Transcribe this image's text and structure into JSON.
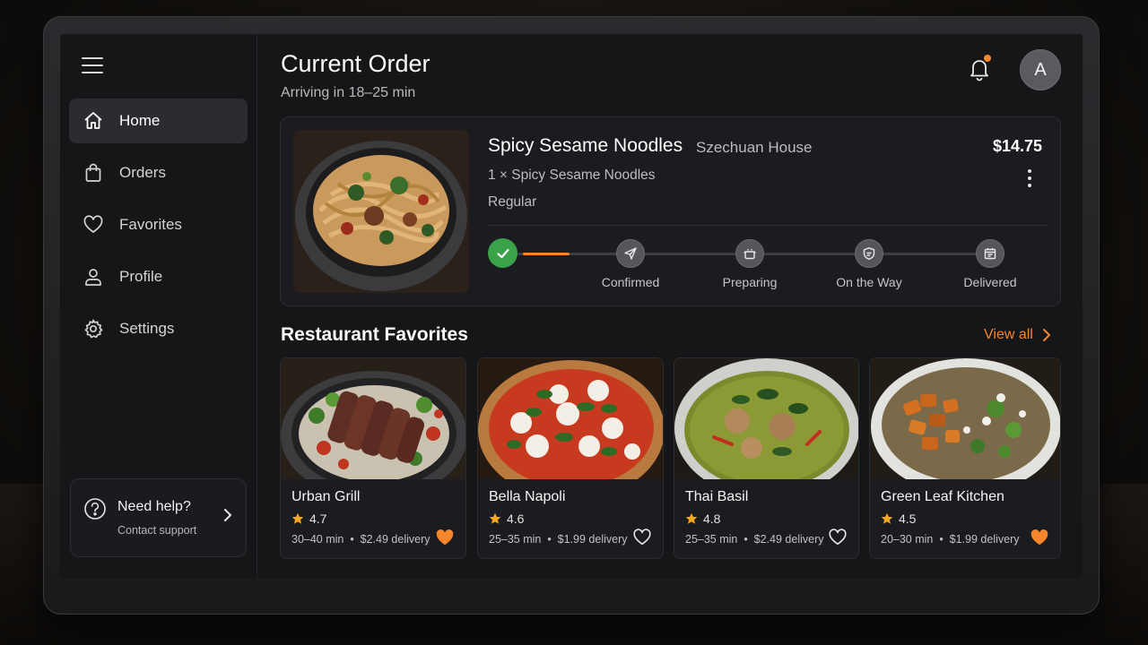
{
  "sidebar": {
    "items": [
      {
        "label": "Home",
        "icon": "home-icon",
        "active": true
      },
      {
        "label": "Orders",
        "icon": "shopping-bag-icon"
      },
      {
        "label": "Favorites",
        "icon": "heart-icon"
      },
      {
        "label": "Profile",
        "icon": "user-icon"
      },
      {
        "label": "Settings",
        "icon": "gear-icon"
      }
    ],
    "help": {
      "title": "Need help?",
      "subtitle": "Contact support"
    }
  },
  "header": {
    "title": "Current Order",
    "subtitle": "Arriving in 18–25 min",
    "avatar_initial": "A",
    "notification_dot": true
  },
  "order": {
    "dish": "Spicy Sesame Noodles",
    "restaurant": "Szechuan House",
    "price": "$14.75",
    "quantity_line": "1 × Spicy Sesame Noodles",
    "size": "Regular",
    "progress_fraction_first_segment": 0.5,
    "steps": [
      {
        "label": "Confirmed",
        "icon": "paper-plane-icon"
      },
      {
        "label": "Preparing",
        "icon": "cooking-pot-icon"
      },
      {
        "label": "On the Way",
        "icon": "shield-icon"
      },
      {
        "label": "Delivered",
        "icon": "calendar-icon"
      }
    ]
  },
  "favorites": {
    "title": "Restaurant Favorites",
    "view_all": "View all",
    "items": [
      {
        "name": "Urban Grill",
        "rating": "4.7",
        "time": "30–40 min",
        "delivery": "$2.49 delivery",
        "favorited": true
      },
      {
        "name": "Bella Napoli",
        "rating": "4.6",
        "time": "25–35 min",
        "delivery": "$1.99 delivery",
        "favorited": false
      },
      {
        "name": "Thai Basil",
        "rating": "4.8",
        "time": "25–35 min",
        "delivery": "$2.49 delivery",
        "favorited": false
      },
      {
        "name": "Green Leaf Kitchen",
        "rating": "4.5",
        "time": "20–30 min",
        "delivery": "$1.99 delivery",
        "favorited": true
      }
    ]
  },
  "colors": {
    "accent": "#f6862b",
    "success": "#3aa34a",
    "background": "#151618",
    "card": "#1b1c1f"
  }
}
